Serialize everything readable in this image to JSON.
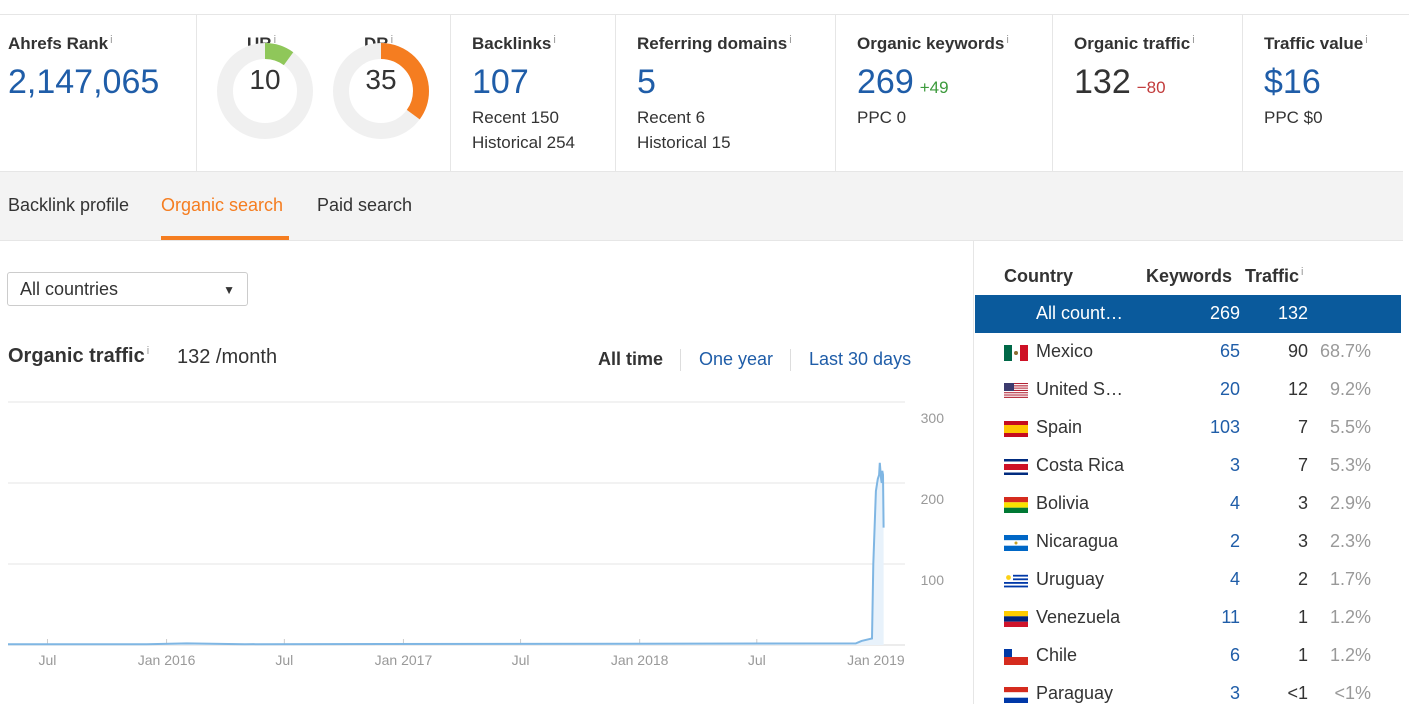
{
  "metrics": {
    "ahrefs_rank": {
      "label": "Ahrefs Rank",
      "value": "2,147,065"
    },
    "ur": {
      "label": "UR",
      "value": "10",
      "score": 10,
      "color": "#8fc75a"
    },
    "dr": {
      "label": "DR",
      "value": "35",
      "score": 35,
      "color": "#f57d20"
    },
    "backlinks": {
      "label": "Backlinks",
      "value": "107",
      "recent": "Recent 150",
      "historical": "Historical 254"
    },
    "referring_domains": {
      "label": "Referring domains",
      "value": "5",
      "recent": "Recent 6",
      "historical": "Historical 15"
    },
    "organic_keywords": {
      "label": "Organic keywords",
      "value": "269",
      "delta": "+49",
      "ppc": "PPC 0"
    },
    "organic_traffic": {
      "label": "Organic traffic",
      "value": "132",
      "delta": "−80"
    },
    "traffic_value": {
      "label": "Traffic value",
      "value": "$16",
      "ppc": "PPC $0"
    },
    "info_glyph": "i"
  },
  "tabs": [
    {
      "label": "Backlink profile",
      "active": false
    },
    {
      "label": "Organic search",
      "active": true
    },
    {
      "label": "Paid search",
      "active": false
    }
  ],
  "country_select": {
    "value": "All countries",
    "caret": "▼"
  },
  "organic": {
    "title": "Organic traffic",
    "value": "132 /month",
    "ranges": [
      {
        "label": "All time",
        "active": true
      },
      {
        "label": "One year",
        "active": false
      },
      {
        "label": "Last 30 days",
        "active": false
      }
    ]
  },
  "colors": {
    "accent": "#f57d20",
    "link": "#1f5da8",
    "selected_row": "#0a5a9c",
    "line": "#7fb6e3"
  },
  "chart_data": {
    "type": "line",
    "title": "",
    "xlabel": "",
    "ylabel": "",
    "ylim": [
      0,
      300
    ],
    "yticks": [
      100,
      200,
      300
    ],
    "xticks": [
      "Jul",
      "Jan 2016",
      "Jul",
      "Jan 2017",
      "Jul",
      "Jan 2018",
      "Jul",
      "Jan 2019"
    ],
    "xtick_dates": [
      "2015-07-01",
      "2016-01-01",
      "2016-07-01",
      "2017-01-01",
      "2017-07-01",
      "2018-01-01",
      "2018-07-01",
      "2019-01-01"
    ],
    "xlim": [
      "2015-05-01",
      "2019-02-15"
    ],
    "grid": true,
    "series": [
      {
        "name": "",
        "values": [
          {
            "x": "2015-05-01",
            "y": 1
          },
          {
            "x": "2015-12-01",
            "y": 1
          },
          {
            "x": "2016-02-01",
            "y": 2
          },
          {
            "x": "2016-05-01",
            "y": 1
          },
          {
            "x": "2018-12-01",
            "y": 2
          },
          {
            "x": "2018-12-10",
            "y": 5
          },
          {
            "x": "2018-12-26",
            "y": 8
          },
          {
            "x": "2018-12-28",
            "y": 100
          },
          {
            "x": "2019-01-01",
            "y": 190
          },
          {
            "x": "2019-01-04",
            "y": 205
          },
          {
            "x": "2019-01-06",
            "y": 210
          },
          {
            "x": "2019-01-07",
            "y": 225
          },
          {
            "x": "2019-01-09",
            "y": 205
          },
          {
            "x": "2019-01-10",
            "y": 200
          },
          {
            "x": "2019-01-11",
            "y": 215
          },
          {
            "x": "2019-01-12",
            "y": 210
          },
          {
            "x": "2019-01-13",
            "y": 145
          }
        ]
      }
    ]
  },
  "country_table": {
    "headers": {
      "country": "Country",
      "keywords": "Keywords",
      "traffic": "Traffic"
    },
    "rows": [
      {
        "flag": "all",
        "name": "All count…",
        "keywords": "269",
        "traffic": "132",
        "pct": "",
        "selected": true
      },
      {
        "flag": "mx",
        "name": "Mexico",
        "keywords": "65",
        "traffic": "90",
        "pct": "68.7%",
        "selected": false
      },
      {
        "flag": "us",
        "name": "United S…",
        "keywords": "20",
        "traffic": "12",
        "pct": "9.2%",
        "selected": false
      },
      {
        "flag": "es",
        "name": "Spain",
        "keywords": "103",
        "traffic": "7",
        "pct": "5.5%",
        "selected": false
      },
      {
        "flag": "cr",
        "name": "Costa Rica",
        "keywords": "3",
        "traffic": "7",
        "pct": "5.3%",
        "selected": false
      },
      {
        "flag": "bo",
        "name": "Bolivia",
        "keywords": "4",
        "traffic": "3",
        "pct": "2.9%",
        "selected": false
      },
      {
        "flag": "ni",
        "name": "Nicaragua",
        "keywords": "2",
        "traffic": "3",
        "pct": "2.3%",
        "selected": false
      },
      {
        "flag": "uy",
        "name": "Uruguay",
        "keywords": "4",
        "traffic": "2",
        "pct": "1.7%",
        "selected": false
      },
      {
        "flag": "ve",
        "name": "Venezuela",
        "keywords": "11",
        "traffic": "1",
        "pct": "1.2%",
        "selected": false
      },
      {
        "flag": "cl",
        "name": "Chile",
        "keywords": "6",
        "traffic": "1",
        "pct": "1.2%",
        "selected": false
      },
      {
        "flag": "py",
        "name": "Paraguay",
        "keywords": "3",
        "traffic": "<1",
        "pct": "<1%",
        "selected": false
      }
    ]
  }
}
